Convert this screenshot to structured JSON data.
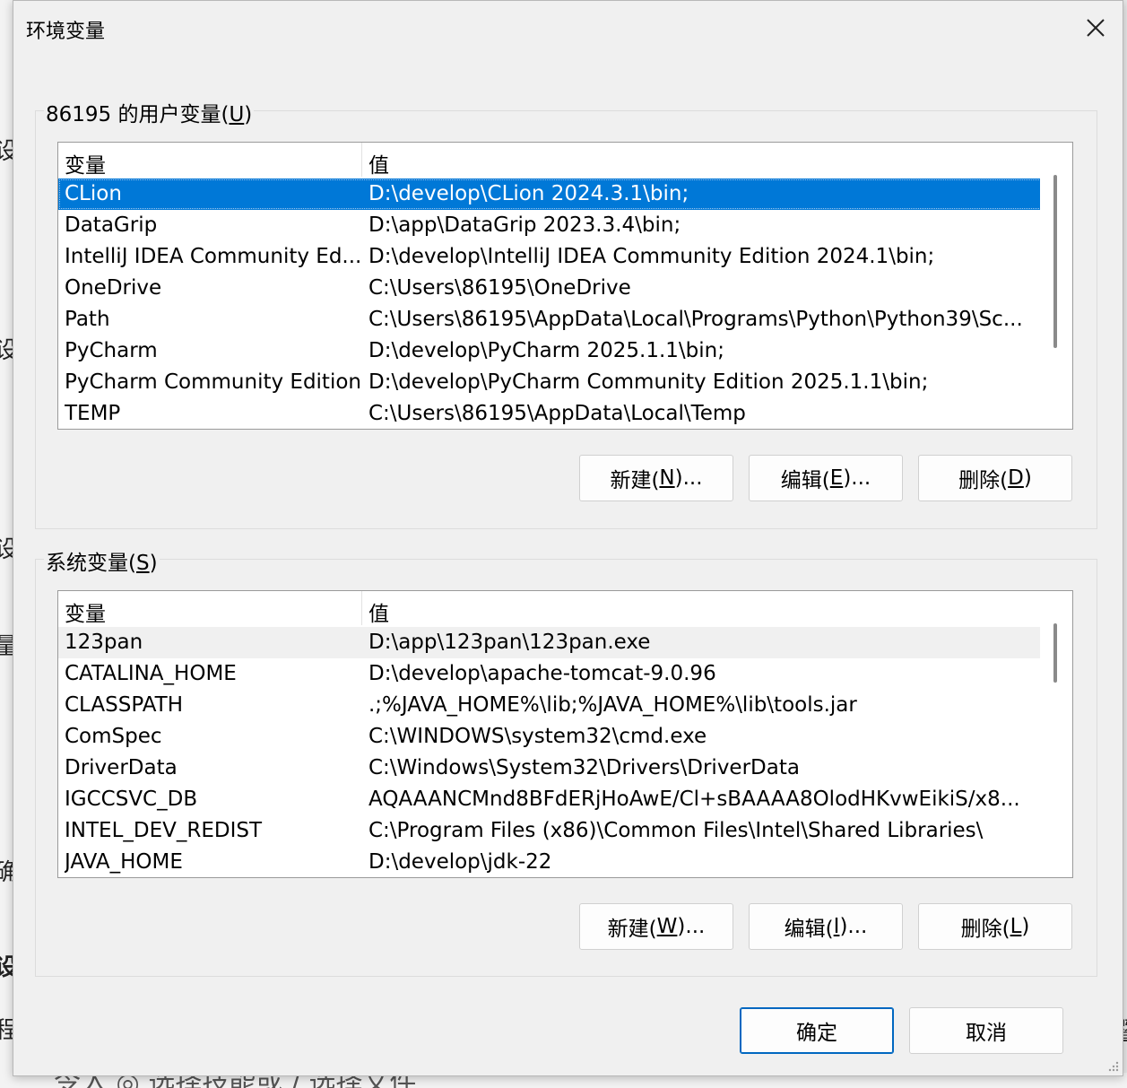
{
  "dialog": {
    "title": "环境变量",
    "close_icon": "close-icon"
  },
  "user_vars": {
    "label_prefix": "86195 的用户变量(",
    "label_accel": "U",
    "label_suffix": ")",
    "col_name": "变量",
    "col_value": "值",
    "rows": [
      {
        "name": "CLion",
        "value": "D:\\develop\\CLion 2024.3.1\\bin;"
      },
      {
        "name": "DataGrip",
        "value": "D:\\app\\DataGrip 2023.3.4\\bin;"
      },
      {
        "name": "IntelliJ IDEA Community Ed...",
        "value": "D:\\develop\\IntelliJ IDEA Community Edition 2024.1\\bin;"
      },
      {
        "name": "OneDrive",
        "value": "C:\\Users\\86195\\OneDrive"
      },
      {
        "name": "Path",
        "value": "C:\\Users\\86195\\AppData\\Local\\Programs\\Python\\Python39\\Sc..."
      },
      {
        "name": "PyCharm",
        "value": "D:\\develop\\PyCharm 2025.1.1\\bin;"
      },
      {
        "name": "PyCharm Community Edition",
        "value": "D:\\develop\\PyCharm Community Edition 2025.1.1\\bin;"
      },
      {
        "name": "TEMP",
        "value": "C:\\Users\\86195\\AppData\\Local\\Temp"
      }
    ],
    "buttons": {
      "new_prefix": "新建(",
      "new_accel": "N",
      "new_suffix": ")...",
      "edit_prefix": "编辑(",
      "edit_accel": "E",
      "edit_suffix": ")...",
      "delete_prefix": "删除(",
      "delete_accel": "D",
      "delete_suffix": ")"
    }
  },
  "system_vars": {
    "label_prefix": "系统变量(",
    "label_accel": "S",
    "label_suffix": ")",
    "col_name": "变量",
    "col_value": "值",
    "rows": [
      {
        "name": "123pan",
        "value": "D:\\app\\123pan\\123pan.exe"
      },
      {
        "name": "CATALINA_HOME",
        "value": "D:\\develop\\apache-tomcat-9.0.96"
      },
      {
        "name": "CLASSPATH",
        "value": ".;%JAVA_HOME%\\lib;%JAVA_HOME%\\lib\\tools.jar"
      },
      {
        "name": "ComSpec",
        "value": "C:\\WINDOWS\\system32\\cmd.exe"
      },
      {
        "name": "DriverData",
        "value": "C:\\Windows\\System32\\Drivers\\DriverData"
      },
      {
        "name": "IGCCSVC_DB",
        "value": "AQAAANCMnd8BFdERjHoAwE/Cl+sBAAAA8OlodHKvwEikiS/x8..."
      },
      {
        "name": "INTEL_DEV_REDIST",
        "value": "C:\\Program Files (x86)\\Common Files\\Intel\\Shared Libraries\\"
      },
      {
        "name": "JAVA_HOME",
        "value": "D:\\develop\\jdk-22"
      }
    ],
    "buttons": {
      "new_prefix": "新建(",
      "new_accel": "W",
      "new_suffix": ")...",
      "edit_prefix": "编辑(",
      "edit_accel": "I",
      "edit_suffix": ")...",
      "delete_prefix": "删除(",
      "delete_accel": "L",
      "delete_suffix": ")"
    }
  },
  "footer": {
    "ok_label": "确定",
    "cancel_label": "取消"
  },
  "background": {
    "bottom_text": "令入 ◎ 选择技能或 / 选择文件",
    "left_glyphs": [
      "设",
      "设",
      "设",
      "量",
      "确",
      "设",
      "程"
    ],
    "right_glyph": "暨"
  },
  "colors": {
    "selection": "#0078d7",
    "primary_border": "#0067c0",
    "dialog_bg": "#f0f0f0"
  }
}
